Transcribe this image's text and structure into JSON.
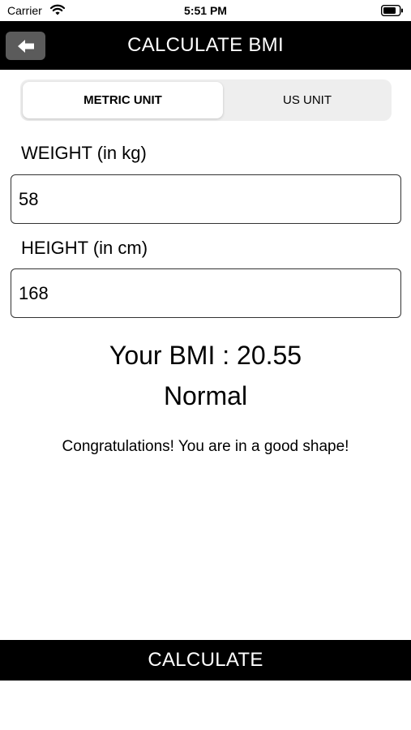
{
  "status_bar": {
    "carrier": "Carrier",
    "time": "5:51 PM",
    "icons": [
      "wifi-icon",
      "battery-icon"
    ]
  },
  "nav": {
    "title": "CALCULATE BMI",
    "back_icon": "arrow-left-icon"
  },
  "unit_selector": {
    "options": [
      "METRIC UNIT",
      "US UNIT"
    ],
    "selected": "METRIC UNIT"
  },
  "form": {
    "weight_label": "WEIGHT (in kg)",
    "weight_value": "58",
    "height_label": "HEIGHT (in cm)",
    "height_value": "168"
  },
  "result": {
    "bmi_text": "Your BMI : 20.55",
    "category": "Normal",
    "message": "Congratulations! You are in a good shape!"
  },
  "actions": {
    "calculate_label": "CALCULATE"
  },
  "colors": {
    "bar": "#000000",
    "back_button": "#5b5b5b",
    "segment_bg": "#eeeeee"
  }
}
